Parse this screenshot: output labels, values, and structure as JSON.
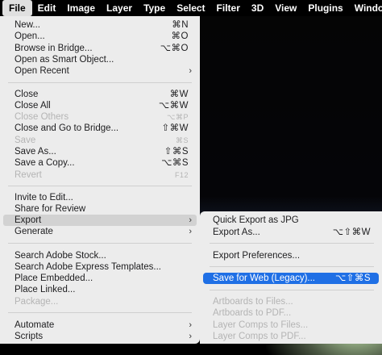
{
  "menubar": {
    "items": [
      {
        "label": "File"
      },
      {
        "label": "Edit"
      },
      {
        "label": "Image"
      },
      {
        "label": "Layer"
      },
      {
        "label": "Type"
      },
      {
        "label": "Select"
      },
      {
        "label": "Filter"
      },
      {
        "label": "3D"
      },
      {
        "label": "View"
      },
      {
        "label": "Plugins"
      },
      {
        "label": "Window"
      }
    ]
  },
  "file_menu": {
    "items": [
      {
        "label": "New...",
        "shortcut": "⌘N"
      },
      {
        "label": "Open...",
        "shortcut": "⌘O"
      },
      {
        "label": "Browse in Bridge...",
        "shortcut": "⌥⌘O"
      },
      {
        "label": "Open as Smart Object..."
      },
      {
        "label": "Open Recent",
        "submenu_icon": "chevron-right-icon",
        "chevron": "›"
      },
      {
        "label": "Close",
        "shortcut": "⌘W"
      },
      {
        "label": "Close All",
        "shortcut": "⌥⌘W"
      },
      {
        "label": "Close Others",
        "shortcut": "⌥⌘P"
      },
      {
        "label": "Close and Go to Bridge...",
        "shortcut": "⇧⌘W"
      },
      {
        "label": "Save",
        "shortcut": "⌘S"
      },
      {
        "label": "Save As...",
        "shortcut": "⇧⌘S"
      },
      {
        "label": "Save a Copy...",
        "shortcut": "⌥⌘S"
      },
      {
        "label": "Revert",
        "shortcut": "F12"
      },
      {
        "label": "Invite to Edit..."
      },
      {
        "label": "Share for Review"
      },
      {
        "label": "Export",
        "chevron": "›"
      },
      {
        "label": "Generate",
        "chevron": "›"
      },
      {
        "label": "Search Adobe Stock..."
      },
      {
        "label": "Search Adobe Express Templates..."
      },
      {
        "label": "Place Embedded..."
      },
      {
        "label": "Place Linked..."
      },
      {
        "label": "Package..."
      },
      {
        "label": "Automate",
        "chevron": "›"
      },
      {
        "label": "Scripts",
        "chevron": "›"
      }
    ]
  },
  "export_submenu": {
    "items": [
      {
        "label": "Quick Export as JPG"
      },
      {
        "label": "Export As...",
        "shortcut": "⌥⇧⌘W"
      },
      {
        "label": "Export Preferences..."
      },
      {
        "label": "Save for Web (Legacy)...",
        "shortcut": "⌥⇧⌘S"
      },
      {
        "label": "Artboards to Files..."
      },
      {
        "label": "Artboards to PDF..."
      },
      {
        "label": "Layer Comps to Files..."
      },
      {
        "label": "Layer Comps to PDF..."
      }
    ]
  },
  "colors": {
    "menu_bg": "#ececec",
    "selection": "#1f6fe5",
    "disabled_text": "#b4b4b4",
    "menubar_bg": "#000000"
  }
}
